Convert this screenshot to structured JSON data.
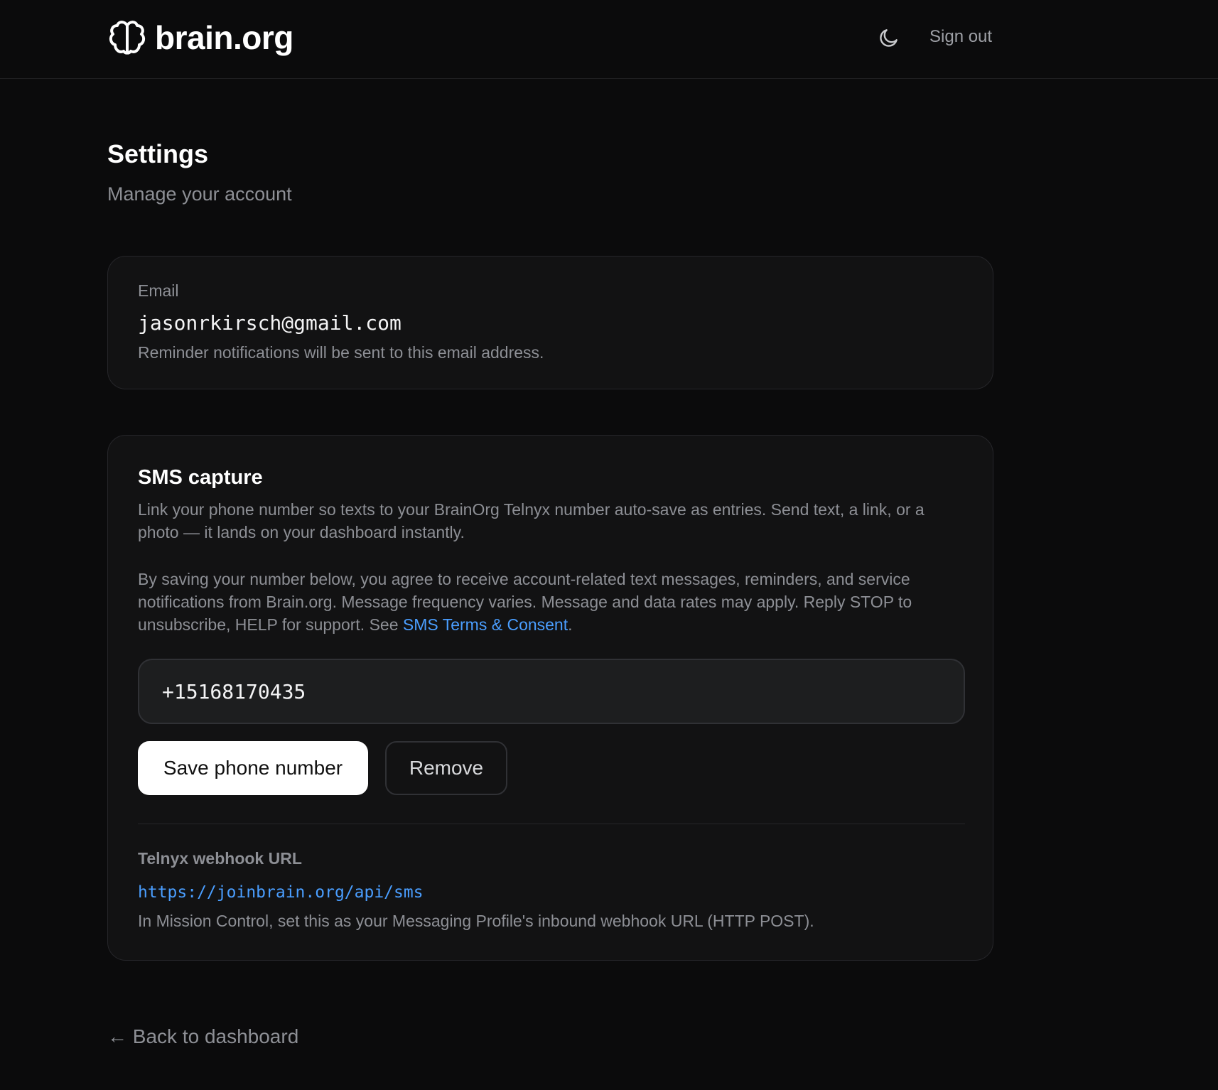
{
  "header": {
    "logo_text": "brain.org",
    "logo_icon": "brain-icon",
    "theme_toggle_icon": "moon-icon",
    "signout_label": "Sign out"
  },
  "page": {
    "title": "Settings",
    "subtitle": "Manage your account"
  },
  "email_card": {
    "label": "Email",
    "value": "jasonrkirsch@gmail.com",
    "help": "Reminder notifications will be sent to this email address."
  },
  "sms_card": {
    "title": "SMS capture",
    "description": "Link your phone number so texts to your BrainOrg Telnyx number auto-save as entries. Send text, a link, or a photo — it lands on your dashboard instantly.",
    "consent_prefix": "By saving your number below, you agree to receive account-related text messages, reminders, and service notifications from Brain.org. Message frequency varies. Message and data rates may apply. Reply STOP to unsubscribe, HELP for support. See ",
    "consent_link": "SMS Terms & Consent",
    "consent_suffix": ".",
    "phone_value": "+15168170435",
    "save_label": "Save phone number",
    "remove_label": "Remove",
    "webhook_label": "Telnyx webhook URL",
    "webhook_url": "https://joinbrain.org/api/sms",
    "webhook_help": "In Mission Control, set this as your Messaging Profile's inbound webhook URL (HTTP POST)."
  },
  "footer": {
    "back_label": "← Back to dashboard"
  },
  "colors": {
    "background": "#0b0b0c",
    "card": "#121213",
    "link": "#4a9eff",
    "muted": "#8d8f95"
  }
}
